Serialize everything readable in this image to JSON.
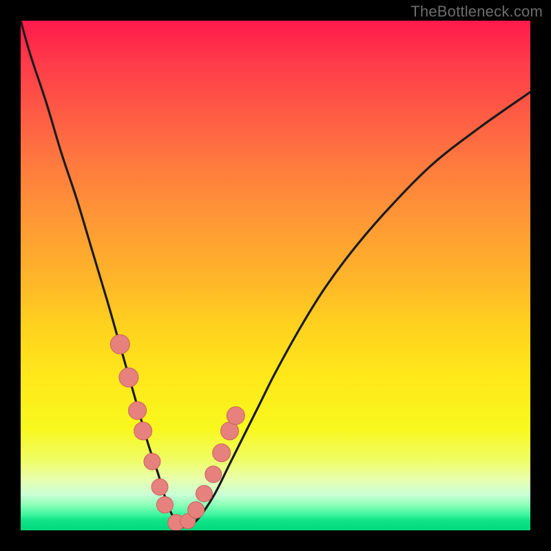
{
  "watermark": "TheBottleneck.com",
  "colors": {
    "frame": "#000000",
    "curve": "#1a1a1a",
    "marker_fill": "#e6817e",
    "marker_stroke": "#c9615d",
    "gradient_top": "#ff1a4b",
    "gradient_bottom": "#00d97c"
  },
  "chart_data": {
    "type": "line",
    "title": "",
    "xlabel": "",
    "ylabel": "",
    "xlim": [
      0,
      100
    ],
    "ylim": [
      0,
      100
    ],
    "note": "No axis ticks or numeric labels are visible; x/y values are estimated image-relative 0–100. y represents vertical distance from bottom (0 = bottom/green, 100 = top/red).",
    "series": [
      {
        "name": "bottleneck-curve",
        "x": [
          0,
          2,
          5,
          8,
          11,
          14,
          17,
          19,
          21,
          23,
          25,
          27,
          28.5,
          30,
          31.5,
          33,
          35,
          38,
          41,
          44,
          47,
          50,
          55,
          60,
          66,
          73,
          81,
          90,
          100
        ],
        "y": [
          100,
          93,
          84,
          74,
          65,
          55,
          45,
          38,
          31,
          24,
          17,
          11,
          6,
          2.5,
          0.8,
          0.8,
          2.5,
          7,
          13,
          19,
          25,
          31,
          40,
          48,
          56,
          64,
          72,
          79,
          86
        ]
      }
    ],
    "markers": {
      "name": "highlighted-points",
      "x": [
        19.5,
        21.2,
        22.9,
        24.0,
        25.8,
        27.3,
        28.3,
        30.5,
        32.8,
        34.4,
        36.0,
        37.8,
        39.4,
        41.0,
        42.2
      ],
      "y": [
        36.5,
        30.0,
        23.5,
        19.5,
        13.5,
        8.5,
        5.0,
        1.5,
        1.8,
        4.0,
        7.2,
        11.0,
        15.2,
        19.5,
        22.5
      ],
      "r": [
        14,
        14,
        13,
        13,
        12,
        12,
        12,
        12,
        11,
        12,
        12,
        12,
        13,
        13,
        13
      ]
    }
  }
}
